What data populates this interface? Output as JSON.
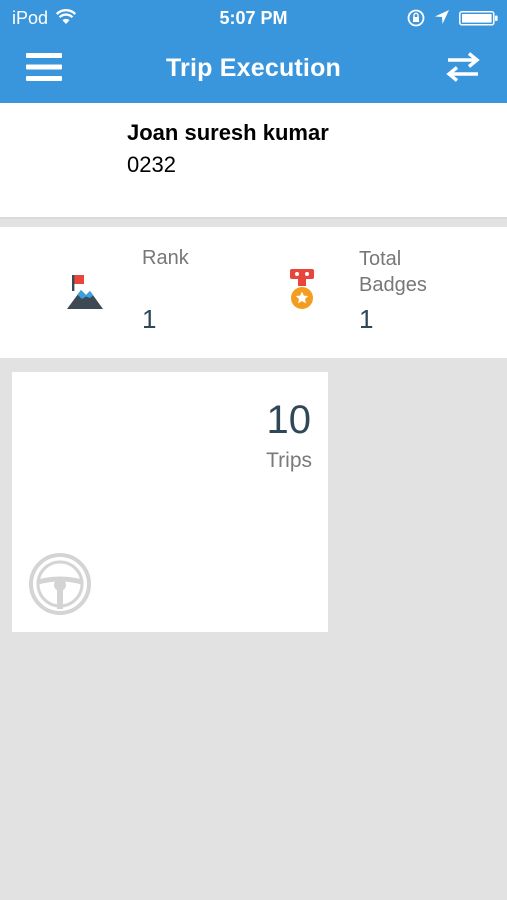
{
  "status_bar": {
    "carrier": "iPod",
    "time": "5:07 PM"
  },
  "header": {
    "title": "Trip Execution",
    "menu_icon": "hamburger-menu-icon",
    "switch_icon": "swap-arrows-icon",
    "background": "#3a96dc"
  },
  "profile": {
    "name": "Joan suresh kumar",
    "id": "0232"
  },
  "stats": {
    "rank": {
      "label": "Rank",
      "value": "1",
      "icon": "mountain-flag-icon"
    },
    "badges": {
      "label": "Total Badges",
      "value": "1",
      "icon": "medal-icon"
    }
  },
  "trips_card": {
    "count": "10",
    "label": "Trips",
    "icon": "steering-wheel-icon"
  }
}
